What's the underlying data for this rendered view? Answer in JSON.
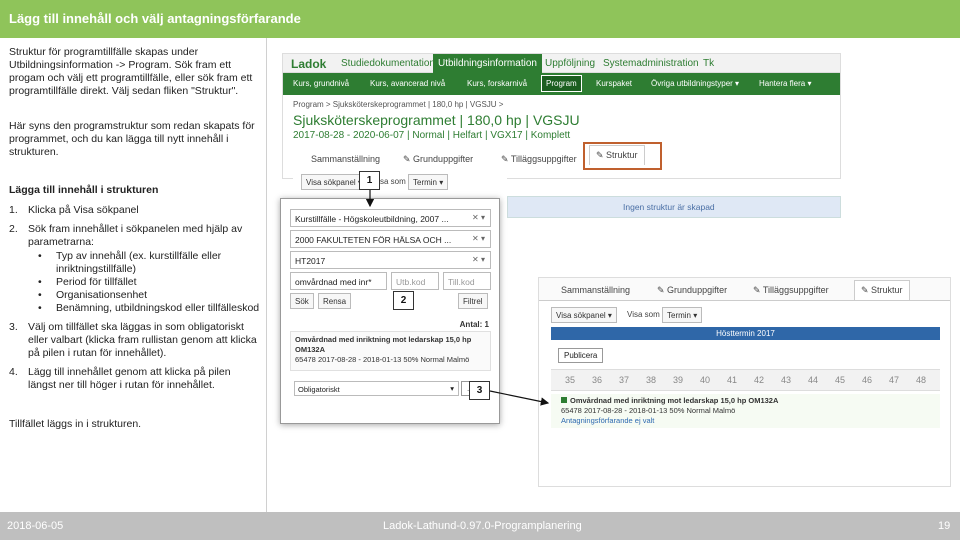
{
  "slide": {
    "title": "Lägg till innehåll och välj antagningsförfarande",
    "intro": "Struktur för programtillfälle skapas under Utbildningsinformation -> Program. Sök fram ett progam och välj ett programtillfälle, eller sök fram ett programtillfälle direkt. Välj sedan fliken \"Struktur\".",
    "intro2": "Här syns den programstruktur som redan skapats för programmet, och du kan lägga till nytt innehåll i strukturen.",
    "heading": "Lägga till innehåll i strukturen",
    "steps": [
      {
        "num": "1.",
        "text": "Klicka på Visa sökpanel"
      },
      {
        "num": "2.",
        "text": "Sök fram innehållet i sökpanelen med hjälp av parametrarna:"
      },
      {
        "num": "3.",
        "text": "Välj om tillfället ska läggas in som obligatoriskt eller valbart (klicka fram rullistan genom att klicka på pilen i rutan för innehållet)."
      },
      {
        "num": "4.",
        "text": "Lägg till innehållet genom att klicka på pilen längst ner till höger i rutan för innehållet."
      }
    ],
    "substeps": [
      "Typ av innehåll (ex. kurstillfälle eller inriktningstillfälle)",
      "Period för tillfället",
      "Organisationsenhet",
      "Benämning, utbildningskod eller tillfälleskod"
    ],
    "closing": "Tillfället läggs in i strukturen.",
    "footer": {
      "date": "2018-06-05",
      "doc": "Ladok-Lathund-0.97.0-Programplanering",
      "page": "19"
    }
  },
  "markers": [
    "1",
    "2",
    "3"
  ],
  "ladok": {
    "logo": "Ladok",
    "topnav": [
      "Studiedokumentation",
      "Utbildningsinformation",
      "Uppföljning",
      "Systemadministration",
      "Tk"
    ],
    "subnav": [
      "Kurs, grundnivå",
      "Kurs, avancerad nivå",
      "Kurs, forskarnivå",
      "Program",
      "Kurspaket",
      "Övriga utbildningstyper ▾",
      "Hantera flera ▾"
    ],
    "breadcrumb": "Program > Sjuksköterskeprogrammet | 180,0 hp | VGSJU >",
    "program_title": "Sjuksköterskeprogrammet | 180,0 hp | VGSJU",
    "program_dates": "2017-08-28 - 2020-06-07 | Normal | Helfart | VGX17 | Komplett",
    "tabs": [
      "Sammanställning",
      "Grunduppgifter",
      "Tilläggsuppgifter",
      "Struktur"
    ],
    "visa_sokpanel": "Visa sökpanel ▾",
    "visa_som": "Visa som",
    "termin": "Termin ▾",
    "no_structure": "Ingen struktur är skapad"
  },
  "search_panel": {
    "type_field": "Kurstillfälle - Högskoleutbildning, 2007 ...",
    "org_field": "2000 FAKULTETEN FÖR HÄLSA OCH ...",
    "period_field": "HT2017",
    "benamning_field": "omvårdnad med inr*",
    "utbkod_placeholder": "Utb.kod",
    "tillkod_placeholder": "Till.kod",
    "sok_btn": "Sök",
    "rensa_btn": "Rensa",
    "filter_btn": "Filtrel",
    "antal": "Antal: 1",
    "result_line1": "Omvårdnad med inriktning mot ledarskap 15,0 hp",
    "result_line2": "OM132A",
    "result_line3": "65478 2017-08-28 - 2018-01-13 50% Normal Malmö",
    "select_value": "Obligatoriskt",
    "add_arrow": "→"
  },
  "structure": {
    "tabs": [
      "Sammanställning",
      "Grunduppgifter",
      "Tilläggsuppgifter",
      "Struktur"
    ],
    "visa_sokpanel": "Visa sökpanel ▾",
    "visa_som": "Visa som",
    "termin": "Termin ▾",
    "semester_header": "Hösttermin 2017",
    "publicera": "Publicera",
    "weeks": [
      "35",
      "36",
      "37",
      "38",
      "39",
      "40",
      "41",
      "42",
      "43",
      "44",
      "45",
      "46",
      "47",
      "48"
    ],
    "course_line1": "Omvårdnad med inriktning mot ledarskap 15,0 hp OM132A",
    "course_line2": "65478 2017-08-28 - 2018-01-13 50% Normal Malmö",
    "course_link": "Antagningsförfarande ej valt"
  }
}
